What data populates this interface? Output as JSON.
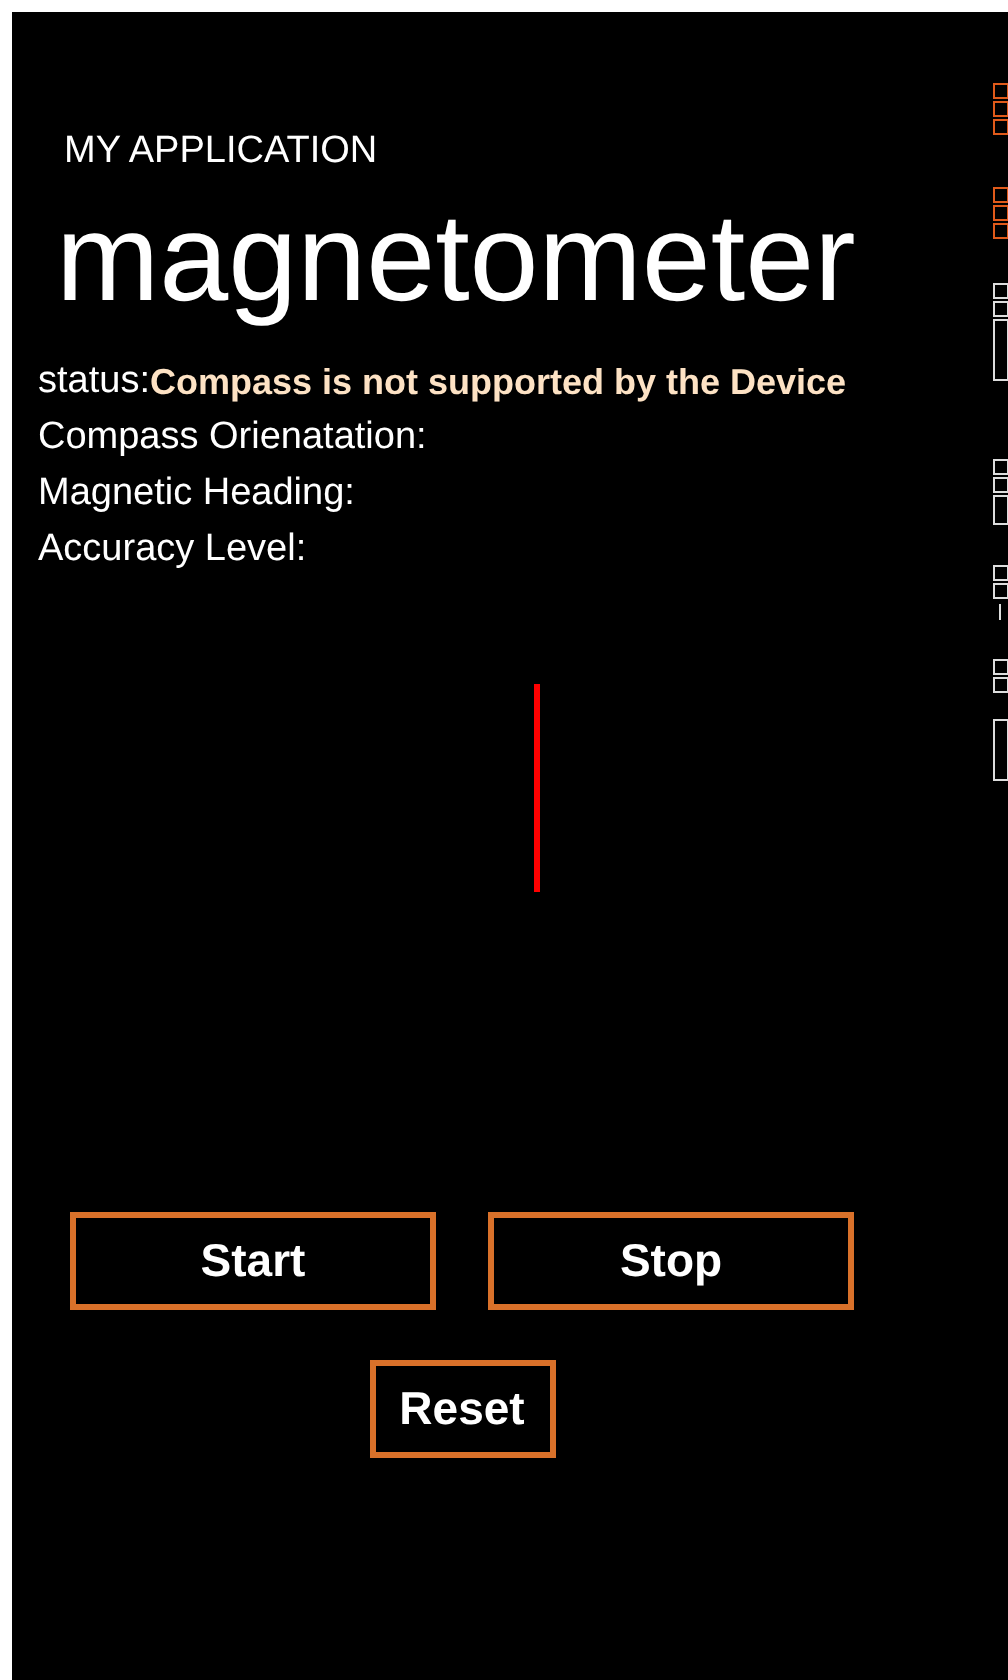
{
  "app_title": "MY APPLICATION",
  "page_title": "magnetometer",
  "status": {
    "label": "status:",
    "value": "Compass is not supported by the Device"
  },
  "fields": [
    {
      "label": "Compass Orienatation:"
    },
    {
      "label": "Magnetic Heading:"
    },
    {
      "label": "Accuracy Level:"
    }
  ],
  "buttons": [
    {
      "label": "Start"
    },
    {
      "label": "Stop"
    },
    {
      "label": "Reset"
    }
  ]
}
